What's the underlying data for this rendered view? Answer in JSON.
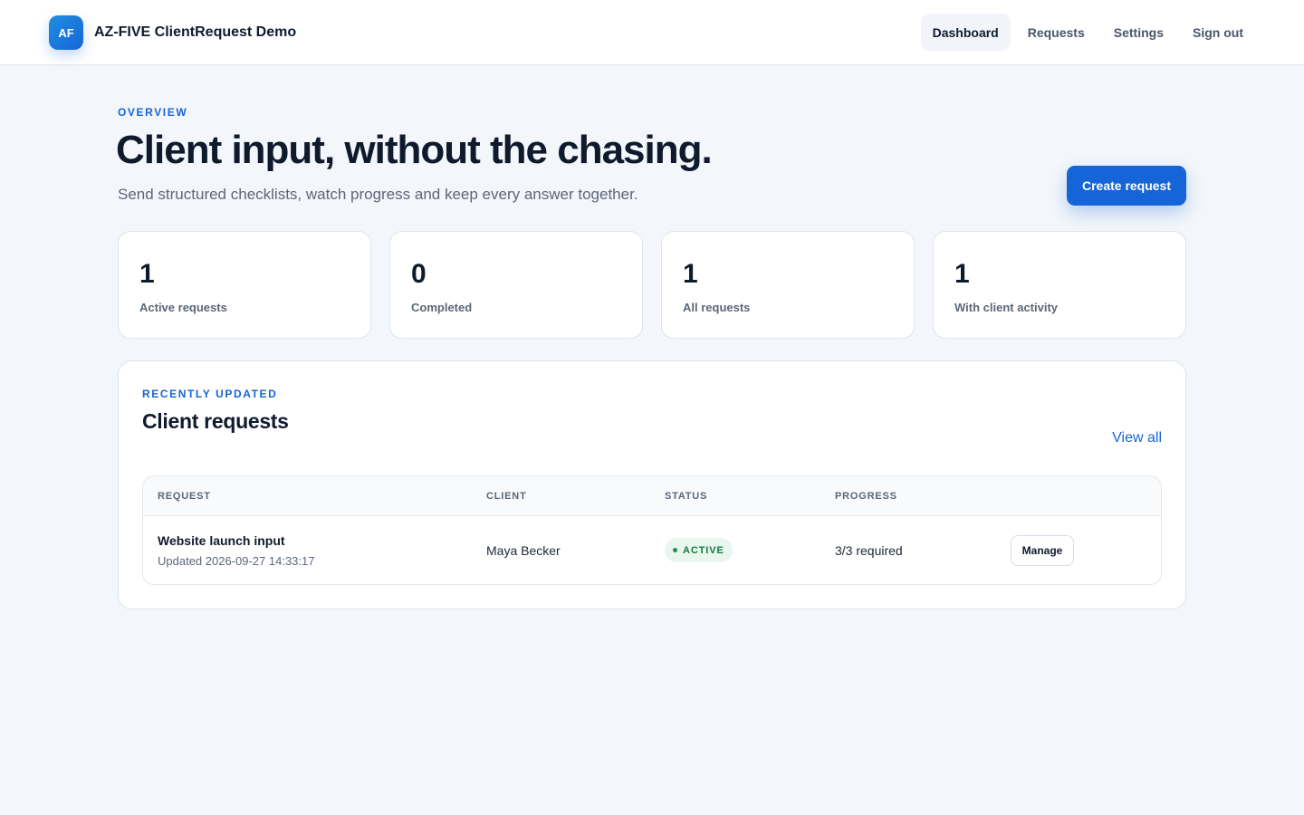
{
  "header": {
    "logo_initials": "AF",
    "app_name": "AZ-FIVE ClientRequest Demo",
    "nav": [
      {
        "label": "Dashboard",
        "active": true
      },
      {
        "label": "Requests",
        "active": false
      },
      {
        "label": "Settings",
        "active": false
      },
      {
        "label": "Sign out",
        "active": false
      }
    ]
  },
  "hero": {
    "eyebrow": "OVERVIEW",
    "title": "Client input, without the chasing.",
    "subtitle": "Send structured checklists, watch progress and keep every answer together.",
    "create_button": "Create request"
  },
  "stats": [
    {
      "value": "1",
      "label": "Active requests"
    },
    {
      "value": "0",
      "label": "Completed"
    },
    {
      "value": "1",
      "label": "All requests"
    },
    {
      "value": "1",
      "label": "With client activity"
    }
  ],
  "panel": {
    "eyebrow": "RECENTLY UPDATED",
    "title": "Client requests",
    "view_all": "View all",
    "columns": [
      "REQUEST",
      "CLIENT",
      "STATUS",
      "PROGRESS"
    ],
    "rows": [
      {
        "request": "Website launch input",
        "updated": "Updated 2026-09-27 14:33:17",
        "client": "Maya Becker",
        "status": "ACTIVE",
        "progress": "3/3 required",
        "action": "Manage"
      }
    ]
  },
  "colors": {
    "accent": "#1565d8",
    "background": "#f3f6fa",
    "status_active": "#137a3f"
  }
}
